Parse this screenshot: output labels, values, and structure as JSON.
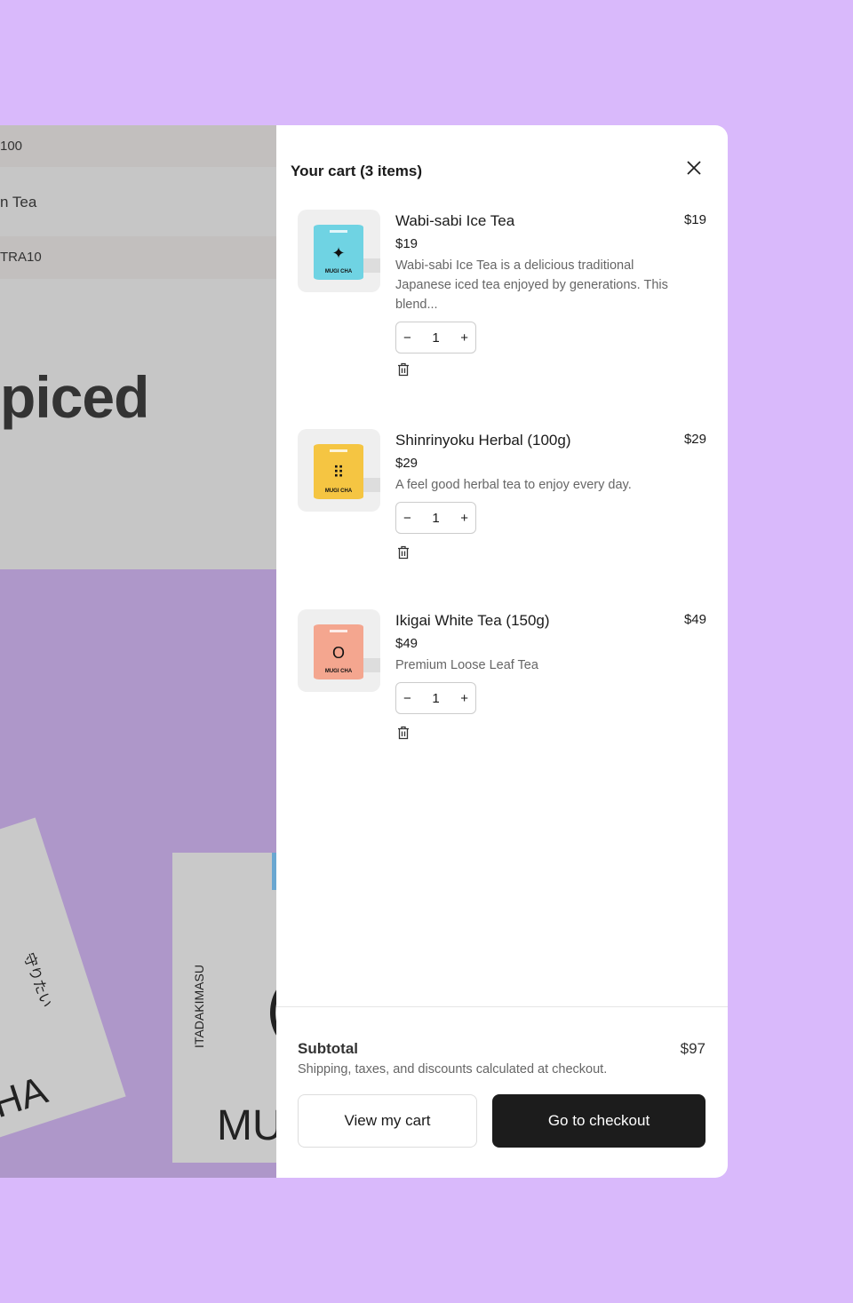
{
  "background": {
    "row1": "100",
    "row2": "n Tea",
    "row3": "TRA10",
    "headline": "piced",
    "card_jp": "守りたい",
    "card_ha": "HA",
    "card_vertical": "ITADAKIMASU",
    "card_mu": "MU"
  },
  "cart": {
    "title": "Your cart (3 items)",
    "items": [
      {
        "name": "Wabi-sabi Ice Tea",
        "price": "$19",
        "line_total": "$19",
        "description": "Wabi-sabi Ice Tea is a delicious traditional Japanese iced tea enjoyed by generations. This blend...",
        "quantity": "1",
        "can_color": "#6fd3e3",
        "symbol": "✦",
        "brand": "MUGI CHA"
      },
      {
        "name": "Shinrinyoku Herbal (100g)",
        "price": "$29",
        "line_total": "$29",
        "description": "A feel good herbal tea to enjoy every day.",
        "quantity": "1",
        "can_color": "#f5c542",
        "symbol": "⠿",
        "brand": "MUGI CHA"
      },
      {
        "name": "Ikigai White Tea (150g)",
        "price": "$49",
        "line_total": "$49",
        "description": "Premium Loose Leaf Tea",
        "quantity": "1",
        "can_color": "#f4a68f",
        "symbol": "O",
        "brand": "MUGI CHA"
      }
    ],
    "minus": "−",
    "plus": "+",
    "subtotal_label": "Subtotal",
    "subtotal_value": "$97",
    "note": "Shipping, taxes, and discounts calculated at checkout.",
    "view_cart": "View my cart",
    "checkout": "Go to checkout"
  }
}
